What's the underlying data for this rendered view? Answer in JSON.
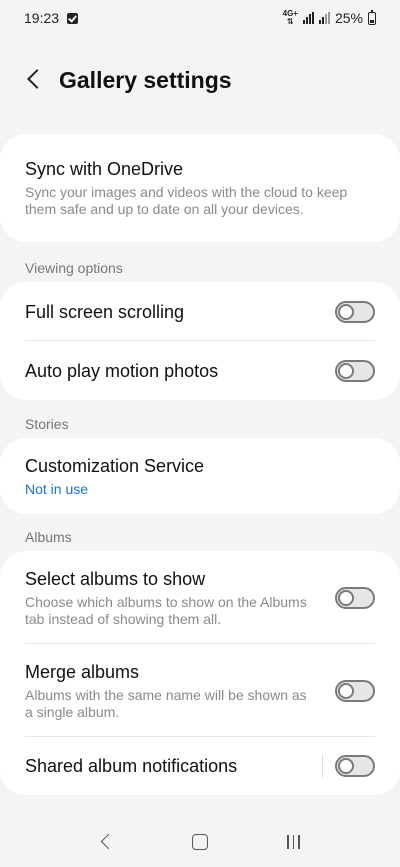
{
  "status_bar": {
    "time": "19:23",
    "network_top": "4G+",
    "network_bottom": "⇅",
    "battery": "25%"
  },
  "header": {
    "title": "Gallery settings"
  },
  "sync": {
    "title": "Sync with OneDrive",
    "description": "Sync your images and videos with the cloud to keep them safe and up to date on all your devices."
  },
  "viewing": {
    "label": "Viewing options",
    "items": [
      {
        "title": "Full screen scrolling",
        "enabled": false
      },
      {
        "title": "Auto play motion photos",
        "enabled": false
      }
    ]
  },
  "stories": {
    "label": "Stories",
    "item": {
      "title": "Customization Service",
      "status": "Not in use"
    }
  },
  "albums": {
    "label": "Albums",
    "items": [
      {
        "title": "Select albums to show",
        "description": "Choose which albums to show on the Albums tab instead of showing them all.",
        "enabled": false
      },
      {
        "title": "Merge albums",
        "description": "Albums with the same name will be shown as a single album.",
        "enabled": false
      },
      {
        "title": "Shared album notifications",
        "enabled": false
      }
    ]
  },
  "colors": {
    "accent": "#1a73c8",
    "background": "#f4f4f4",
    "card": "#ffffff"
  }
}
